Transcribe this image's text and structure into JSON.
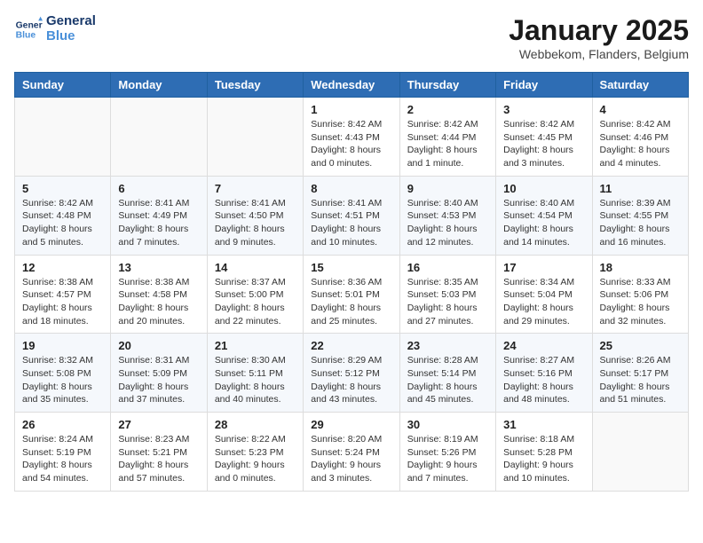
{
  "header": {
    "logo_line1": "General",
    "logo_line2": "Blue",
    "month": "January 2025",
    "location": "Webbekom, Flanders, Belgium"
  },
  "weekdays": [
    "Sunday",
    "Monday",
    "Tuesday",
    "Wednesday",
    "Thursday",
    "Friday",
    "Saturday"
  ],
  "weeks": [
    [
      {
        "day": "",
        "content": ""
      },
      {
        "day": "",
        "content": ""
      },
      {
        "day": "",
        "content": ""
      },
      {
        "day": "1",
        "content": "Sunrise: 8:42 AM\nSunset: 4:43 PM\nDaylight: 8 hours\nand 0 minutes."
      },
      {
        "day": "2",
        "content": "Sunrise: 8:42 AM\nSunset: 4:44 PM\nDaylight: 8 hours\nand 1 minute."
      },
      {
        "day": "3",
        "content": "Sunrise: 8:42 AM\nSunset: 4:45 PM\nDaylight: 8 hours\nand 3 minutes."
      },
      {
        "day": "4",
        "content": "Sunrise: 8:42 AM\nSunset: 4:46 PM\nDaylight: 8 hours\nand 4 minutes."
      }
    ],
    [
      {
        "day": "5",
        "content": "Sunrise: 8:42 AM\nSunset: 4:48 PM\nDaylight: 8 hours\nand 5 minutes."
      },
      {
        "day": "6",
        "content": "Sunrise: 8:41 AM\nSunset: 4:49 PM\nDaylight: 8 hours\nand 7 minutes."
      },
      {
        "day": "7",
        "content": "Sunrise: 8:41 AM\nSunset: 4:50 PM\nDaylight: 8 hours\nand 9 minutes."
      },
      {
        "day": "8",
        "content": "Sunrise: 8:41 AM\nSunset: 4:51 PM\nDaylight: 8 hours\nand 10 minutes."
      },
      {
        "day": "9",
        "content": "Sunrise: 8:40 AM\nSunset: 4:53 PM\nDaylight: 8 hours\nand 12 minutes."
      },
      {
        "day": "10",
        "content": "Sunrise: 8:40 AM\nSunset: 4:54 PM\nDaylight: 8 hours\nand 14 minutes."
      },
      {
        "day": "11",
        "content": "Sunrise: 8:39 AM\nSunset: 4:55 PM\nDaylight: 8 hours\nand 16 minutes."
      }
    ],
    [
      {
        "day": "12",
        "content": "Sunrise: 8:38 AM\nSunset: 4:57 PM\nDaylight: 8 hours\nand 18 minutes."
      },
      {
        "day": "13",
        "content": "Sunrise: 8:38 AM\nSunset: 4:58 PM\nDaylight: 8 hours\nand 20 minutes."
      },
      {
        "day": "14",
        "content": "Sunrise: 8:37 AM\nSunset: 5:00 PM\nDaylight: 8 hours\nand 22 minutes."
      },
      {
        "day": "15",
        "content": "Sunrise: 8:36 AM\nSunset: 5:01 PM\nDaylight: 8 hours\nand 25 minutes."
      },
      {
        "day": "16",
        "content": "Sunrise: 8:35 AM\nSunset: 5:03 PM\nDaylight: 8 hours\nand 27 minutes."
      },
      {
        "day": "17",
        "content": "Sunrise: 8:34 AM\nSunset: 5:04 PM\nDaylight: 8 hours\nand 29 minutes."
      },
      {
        "day": "18",
        "content": "Sunrise: 8:33 AM\nSunset: 5:06 PM\nDaylight: 8 hours\nand 32 minutes."
      }
    ],
    [
      {
        "day": "19",
        "content": "Sunrise: 8:32 AM\nSunset: 5:08 PM\nDaylight: 8 hours\nand 35 minutes."
      },
      {
        "day": "20",
        "content": "Sunrise: 8:31 AM\nSunset: 5:09 PM\nDaylight: 8 hours\nand 37 minutes."
      },
      {
        "day": "21",
        "content": "Sunrise: 8:30 AM\nSunset: 5:11 PM\nDaylight: 8 hours\nand 40 minutes."
      },
      {
        "day": "22",
        "content": "Sunrise: 8:29 AM\nSunset: 5:12 PM\nDaylight: 8 hours\nand 43 minutes."
      },
      {
        "day": "23",
        "content": "Sunrise: 8:28 AM\nSunset: 5:14 PM\nDaylight: 8 hours\nand 45 minutes."
      },
      {
        "day": "24",
        "content": "Sunrise: 8:27 AM\nSunset: 5:16 PM\nDaylight: 8 hours\nand 48 minutes."
      },
      {
        "day": "25",
        "content": "Sunrise: 8:26 AM\nSunset: 5:17 PM\nDaylight: 8 hours\nand 51 minutes."
      }
    ],
    [
      {
        "day": "26",
        "content": "Sunrise: 8:24 AM\nSunset: 5:19 PM\nDaylight: 8 hours\nand 54 minutes."
      },
      {
        "day": "27",
        "content": "Sunrise: 8:23 AM\nSunset: 5:21 PM\nDaylight: 8 hours\nand 57 minutes."
      },
      {
        "day": "28",
        "content": "Sunrise: 8:22 AM\nSunset: 5:23 PM\nDaylight: 9 hours\nand 0 minutes."
      },
      {
        "day": "29",
        "content": "Sunrise: 8:20 AM\nSunset: 5:24 PM\nDaylight: 9 hours\nand 3 minutes."
      },
      {
        "day": "30",
        "content": "Sunrise: 8:19 AM\nSunset: 5:26 PM\nDaylight: 9 hours\nand 7 minutes."
      },
      {
        "day": "31",
        "content": "Sunrise: 8:18 AM\nSunset: 5:28 PM\nDaylight: 9 hours\nand 10 minutes."
      },
      {
        "day": "",
        "content": ""
      }
    ]
  ]
}
